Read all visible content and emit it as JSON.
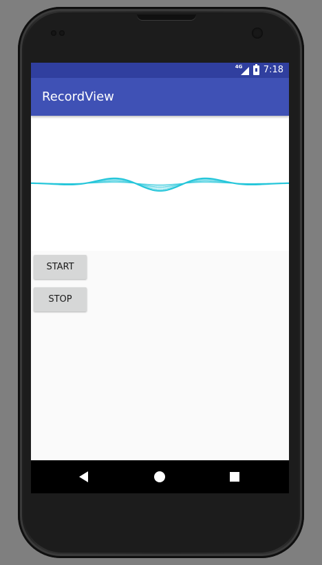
{
  "status_bar": {
    "network_label": "4G",
    "time": "7:18",
    "icons": [
      "signal-icon",
      "battery-icon"
    ]
  },
  "app_bar": {
    "title": "RecordView"
  },
  "waveform": {
    "color": "#26c6da"
  },
  "buttons": {
    "start_label": "START",
    "stop_label": "STOP"
  },
  "nav_bar": {
    "icons": [
      "back-icon",
      "home-icon",
      "recents-icon"
    ]
  },
  "colors": {
    "status_bar": "#303f9f",
    "app_bar": "#3f51b5",
    "background": "#fafafa",
    "button": "#d6d7d7"
  }
}
